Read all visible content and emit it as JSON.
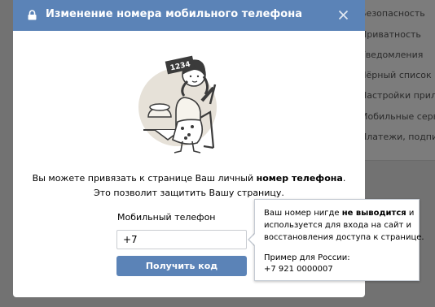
{
  "modal": {
    "title": "Изменение номера мобильного телефона",
    "description_line1_before": "Вы можете привязать к странице Ваш личный ",
    "description_line1_bold": "номер телефона",
    "description_line1_after": ".",
    "description_line2": "Это позволит защитить Вашу страницу.",
    "phone_label": "Мобильный телефон",
    "phone_value": "+7",
    "submit_label": "Получить код",
    "illustration_sign": "1234"
  },
  "tooltip": {
    "line1_before": "Ваш номер нигде ",
    "line1_bold": "не выводится",
    "line1_after": " и",
    "line2": "используется для входа на сайт и",
    "line3": "восстановления доступа к странице.",
    "line4": "Пример для России:",
    "line5": "+7 921 0000007"
  },
  "background_menu": {
    "items": [
      "Безопасность",
      "Приватность",
      "Уведомления",
      "Чёрный список",
      "Настройки прило",
      "Мобильные сервис",
      "Платежи, подписк"
    ]
  },
  "colors": {
    "header": "#5b83b7",
    "button": "#5b83b7",
    "overlay": "#727272"
  }
}
